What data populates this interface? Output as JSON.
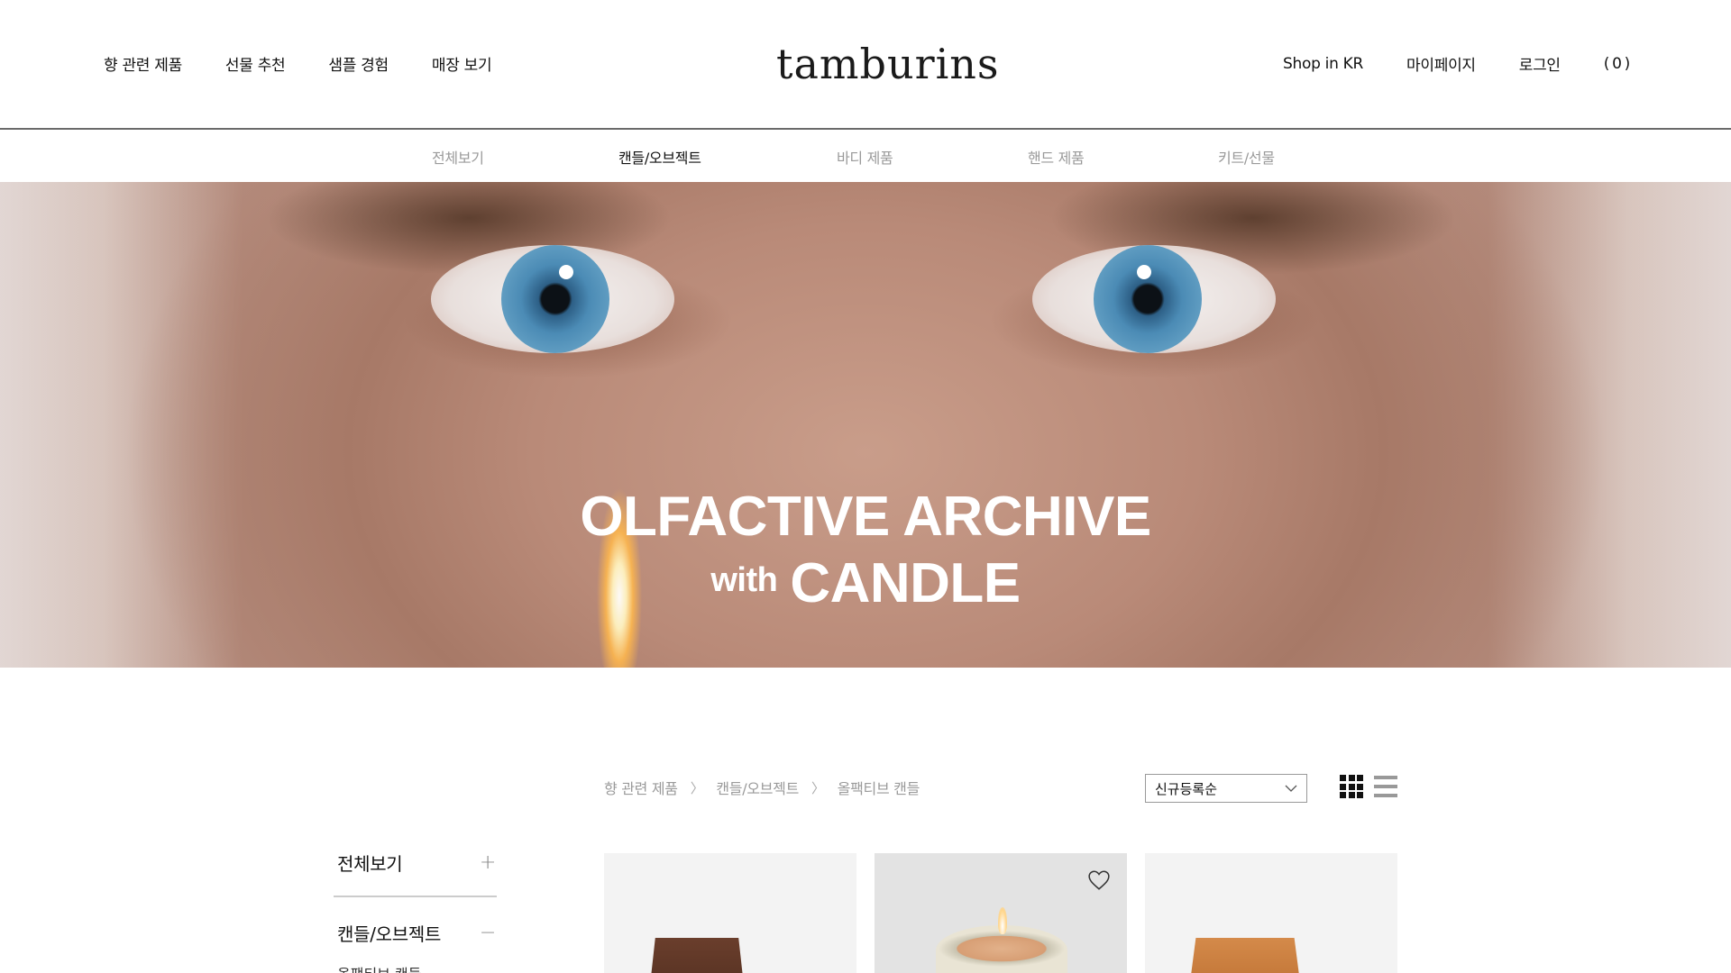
{
  "header": {
    "nav_left": [
      "향 관련 제품",
      "선물 추천",
      "샘플 경험",
      "매장 보기"
    ],
    "logo": "tamburins",
    "nav_right": [
      "Shop in KR",
      "마이페이지",
      "로그인"
    ],
    "cart_open": "(",
    "cart_count": "0",
    "cart_close": ")"
  },
  "category_bar": {
    "items": [
      "전체보기",
      "캔들/오브젝트",
      "바디 제품",
      "핸드 제품",
      "키트/선물"
    ],
    "active": "캔들/오브젝트"
  },
  "hero": {
    "line1": "OLFACTIVE ARCHIVE",
    "line2_small": "with",
    "line2_big": "CANDLE"
  },
  "breadcrumb": [
    "향 관련 제품",
    "캔들/오브젝트",
    "올팩티브 캔들"
  ],
  "breadcrumb_separator": "〉",
  "sort": {
    "selected": "신규등록순"
  },
  "view_toggle": {
    "active": "grid"
  },
  "sidebar": {
    "items": [
      {
        "label": "전체보기",
        "toggle": "+"
      },
      {
        "label": "캔들/오브젝트",
        "toggle": "−"
      }
    ],
    "sub_item": "올팩티브 캔들"
  },
  "colors": {
    "text": "#111111",
    "muted": "#9a9a9a",
    "divider": "#6a6a6a",
    "card_bg": "#f3f3f3",
    "hero_text": "#ffffff"
  }
}
